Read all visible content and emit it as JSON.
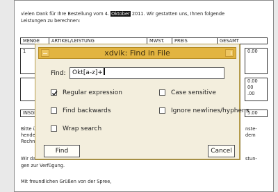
{
  "document": {
    "intro_line1_a": "vielen Dank für Ihre Bestellung vom 4.",
    "intro_highlight": "Oktober",
    "intro_line1_b": "2011. Wir gestatten uns, Ihnen folgende",
    "intro_line2": "Leistungen zu berechnen:",
    "table_headers": [
      "MENGE",
      "ARTIKEL/LEISTUNG",
      "MWST.",
      "PREIS",
      "GESAMT"
    ],
    "row1_qty": "1",
    "row1_total": "0.00",
    "sub_lines": [
      "0.00",
      "00",
      ".00"
    ],
    "sum_label": "INSGE",
    "sum_total": "5.00",
    "para1_left": [
      "Bitte ü",
      "hende",
      "Rechn"
    ],
    "para1_right": [
      "nste-",
      "dem"
    ],
    "para2_left": "Wir da",
    "para2_right": "stun-",
    "para2_line2": "gen zur Verfügung.",
    "closing": "Mit freundlichen Grüßen von der Spree,"
  },
  "dialog": {
    "title": "xdvik: Find in File",
    "find_label": "Find:",
    "find_value": "Okt[a-z]+",
    "options": {
      "regex": {
        "label": "Regular expression",
        "checked": true
      },
      "case": {
        "label": "Case sensitive",
        "checked": false
      },
      "backwards": {
        "label": "Find backwards",
        "checked": false
      },
      "newlines": {
        "label": "Ignore newlines/hyphens",
        "checked": false
      },
      "wrap": {
        "label": "Wrap search",
        "checked": false
      }
    },
    "find_button": "Find",
    "cancel_button": "Cancel"
  }
}
